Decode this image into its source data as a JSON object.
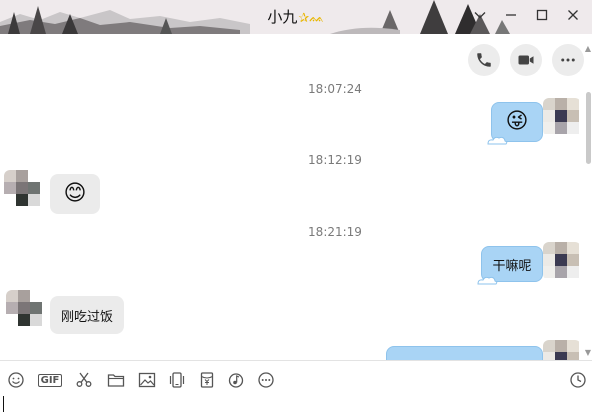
{
  "window": {
    "title": "小九",
    "title_decoration": "✰ᨐ"
  },
  "header_actions": [
    {
      "name": "voice-call-button",
      "icon": "phone-icon"
    },
    {
      "name": "video-call-button",
      "icon": "video-camera-icon"
    },
    {
      "name": "more-button",
      "icon": "more-dots-icon"
    }
  ],
  "messages": [
    {
      "timestamp": "18:07:24",
      "side": "right",
      "content": "😜",
      "kind": "emoji"
    },
    {
      "timestamp": "18:12:19",
      "side": "left",
      "content": "😊",
      "kind": "emoji"
    },
    {
      "timestamp": "18:21:19",
      "side": "right",
      "content": "干嘛呢",
      "kind": "text"
    },
    {
      "side": "left",
      "content": "刚吃过饭",
      "kind": "text"
    },
    {
      "side": "right",
      "content": "",
      "kind": "text"
    }
  ],
  "toolbar": {
    "gif_label": "GIF",
    "tools": [
      "emoji-icon",
      "gif-icon",
      "scissors-icon",
      "folder-icon",
      "image-icon",
      "shake-icon",
      "red-packet-icon",
      "music-icon",
      "more-icon",
      "history-clock-icon"
    ]
  },
  "input": {
    "value": ""
  },
  "colors": {
    "outgoing_bubble": "#a9d4f5",
    "incoming_bubble": "#ebebeb"
  }
}
